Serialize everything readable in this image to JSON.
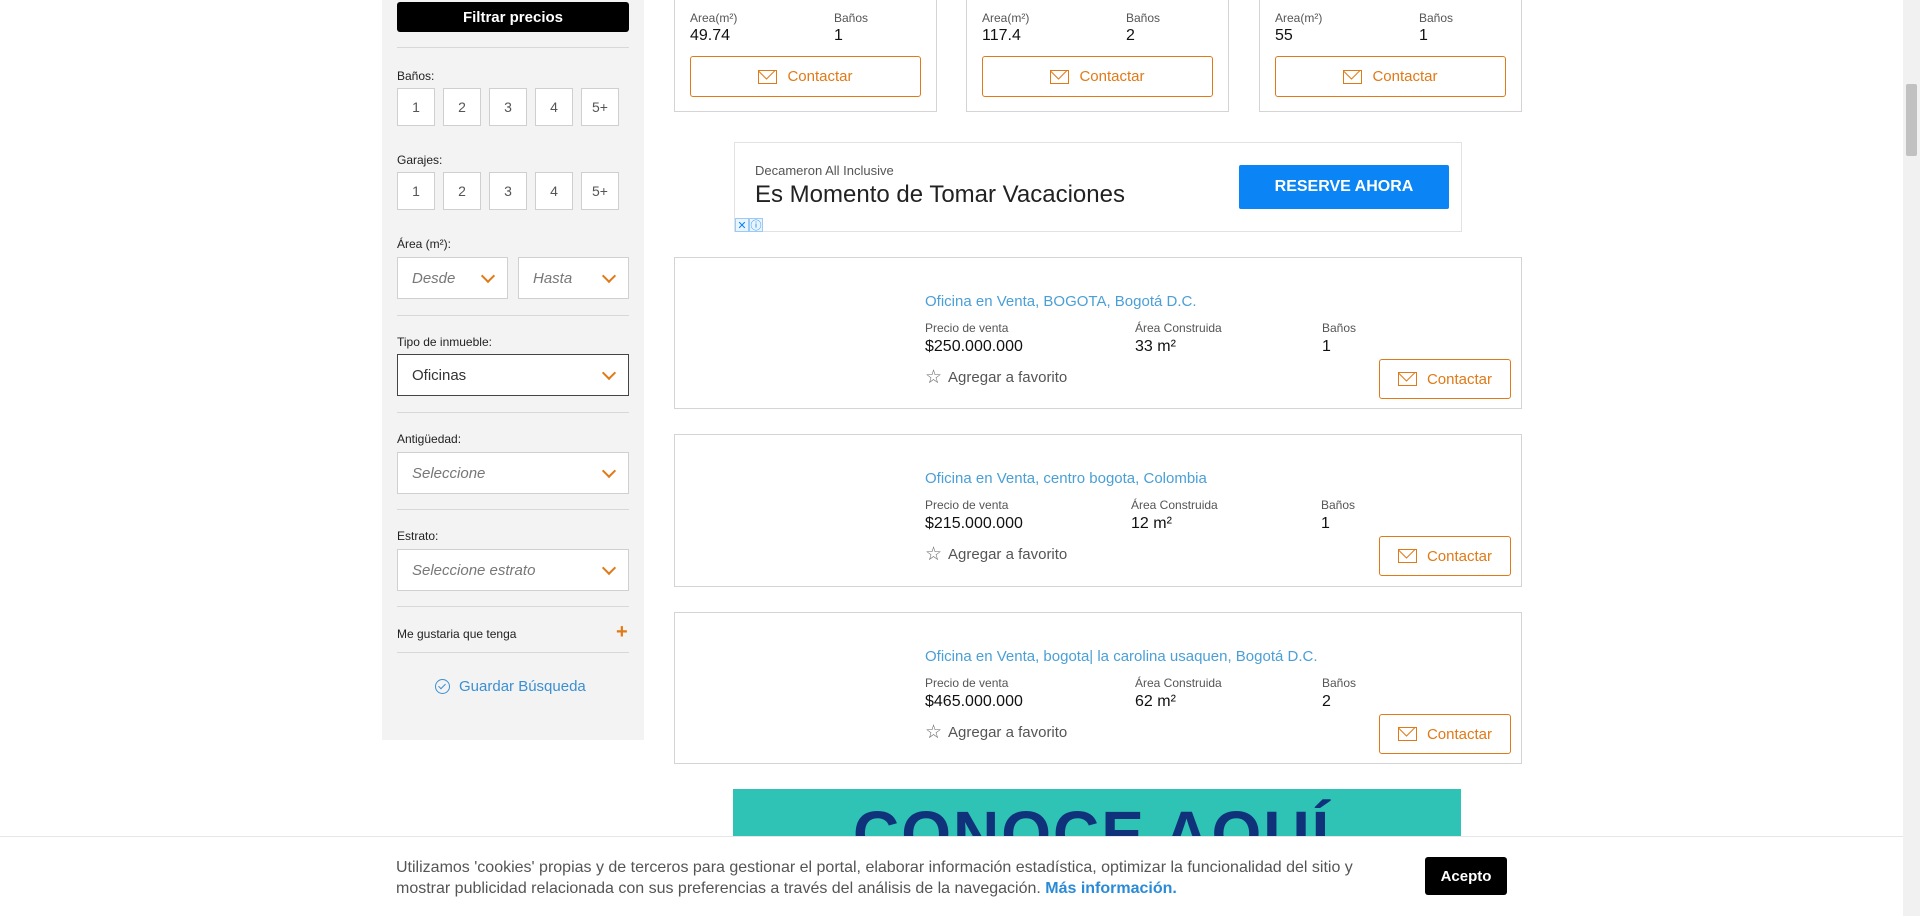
{
  "sidebar": {
    "filter_button": "Filtrar precios",
    "banos_label": "Baños:",
    "banos_options": [
      "1",
      "2",
      "3",
      "4",
      "5+"
    ],
    "garajes_label": "Garajes:",
    "garajes_options": [
      "1",
      "2",
      "3",
      "4",
      "5+"
    ],
    "area_label": "Área (m²):",
    "area_from": "Desde",
    "area_to": "Hasta",
    "tipo_label": "Tipo de inmueble:",
    "tipo_value": "Oficinas",
    "antiguedad_label": "Antigüedad:",
    "antiguedad_value": "Seleccione",
    "estrato_label": "Estrato:",
    "estrato_value": "Seleccione estrato",
    "me_gustaria": "Me gustaria que tenga",
    "guardar": "Guardar Búsqueda"
  },
  "top_cards": [
    {
      "area_label": "Area(m²)",
      "area": "49.74",
      "banos_label": "Baños",
      "banos": "1",
      "contact": "Contactar"
    },
    {
      "area_label": "Area(m²)",
      "area": "117.4",
      "banos_label": "Baños",
      "banos": "2",
      "contact": "Contactar"
    },
    {
      "area_label": "Area(m²)",
      "area": "55",
      "banos_label": "Baños",
      "banos": "1",
      "contact": "Contactar"
    }
  ],
  "ad": {
    "brand": "Decameron All Inclusive",
    "headline": "Es Momento de Tomar Vacaciones",
    "cta": "RESERVE AHORA",
    "close": "✕",
    "info": "ⓘ"
  },
  "listings": [
    {
      "title": "Oficina en Venta, BOGOTA, Bogotá D.C.",
      "price_label": "Precio de venta",
      "price": "$250.000.000",
      "area_label": "Área Construida",
      "area": "33 m²",
      "banos_label": "Baños",
      "banos": "1",
      "fav": "Agregar a favorito",
      "contact": "Contactar"
    },
    {
      "title": "Oficina en Venta, centro bogota, Colombia",
      "price_label": "Precio de venta",
      "price": "$215.000.000",
      "area_label": "Área Construida",
      "area": "12 m²",
      "banos_label": "Baños",
      "banos": "1",
      "fav": "Agregar a favorito",
      "contact": "Contactar"
    },
    {
      "title": "Oficina en Venta, bogota| la carolina usaquen, Bogotá D.C.",
      "price_label": "Precio de venta",
      "price": "$465.000.000",
      "area_label": "Área Construida",
      "area": "62 m²",
      "banos_label": "Baños",
      "banos": "2",
      "fav": "Agregar a favorito",
      "contact": "Contactar"
    }
  ],
  "banner": {
    "text": "CONOCE AQUÍ",
    "left_arrows": "»»",
    "right_arrows": "««"
  },
  "cookie": {
    "text": "Utilizamos 'cookies' propias y de terceros para gestionar el portal, elaborar información estadística, optimizar la funcionalidad del sitio y mostrar publicidad relacionada con sus preferencias a través del análisis de la navegación.",
    "more": "Más información.",
    "accept": "Acepto"
  }
}
